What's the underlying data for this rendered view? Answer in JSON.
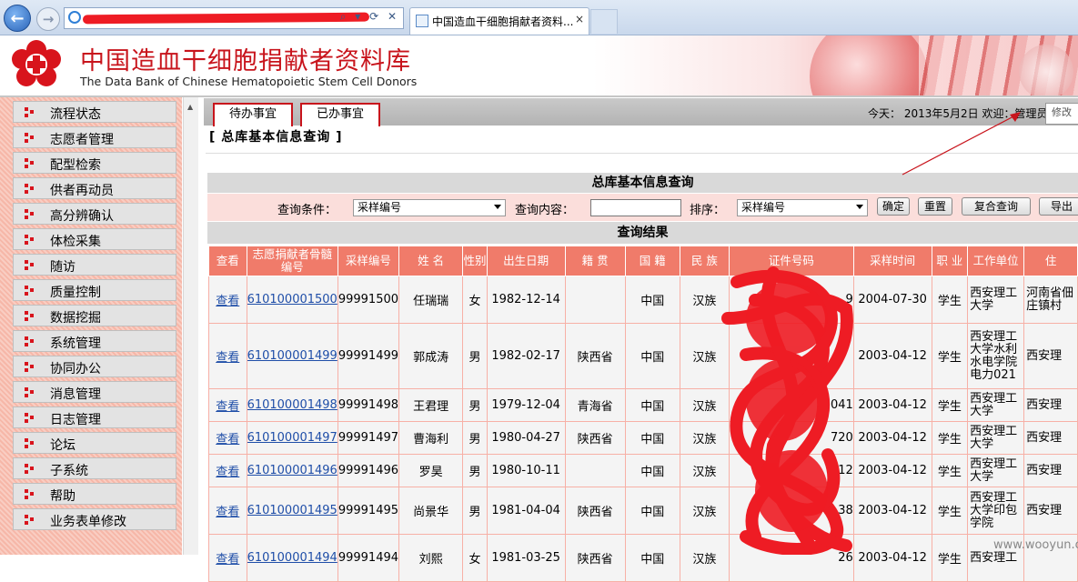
{
  "browser": {
    "tab_title": "中国造血干细胞捐献者资料...",
    "tab_close": "×",
    "address_tools": "⌕ ▾ ⟳ ✕"
  },
  "header": {
    "title_cn": "中国造血干细胞捐献者资料库",
    "title_en": "The Data Bank of Chinese Hematopoietic Stem Cell Donors"
  },
  "sidebar": {
    "items": [
      {
        "label": "流程状态"
      },
      {
        "label": "志愿者管理"
      },
      {
        "label": "配型检索"
      },
      {
        "label": "供者再动员"
      },
      {
        "label": "高分辨确认"
      },
      {
        "label": "体检采集"
      },
      {
        "label": "随访"
      },
      {
        "label": "质量控制"
      },
      {
        "label": "数据挖掘"
      },
      {
        "label": "系统管理"
      },
      {
        "label": "协同办公"
      },
      {
        "label": "消息管理"
      },
      {
        "label": "日志管理"
      },
      {
        "label": "论坛"
      },
      {
        "label": "子系统"
      },
      {
        "label": "帮助"
      },
      {
        "label": "业务表单修改"
      }
    ]
  },
  "main_tabs": {
    "pending": "待办事宜",
    "done": "已办事宜"
  },
  "status": {
    "date_text": "今天： 2013年5月2日 欢迎：管理员",
    "modify_label": "修改"
  },
  "page_title": "[ 总库基本信息查询 ]",
  "query": {
    "header": "总库基本信息查询",
    "condition_label": "查询条件：",
    "condition_value": "采样编号",
    "content_label": "查询内容：",
    "content_value": "",
    "sort_label": "排序：",
    "sort_value": "采样编号",
    "buttons": {
      "confirm": "确定",
      "reset": "重置",
      "compound": "复合查询",
      "export": "导出"
    }
  },
  "results": {
    "header": "查询结果",
    "columns": [
      "查看",
      "志愿捐献者骨髓编号",
      "采样编号",
      "姓 名",
      "性别",
      "出生日期",
      "籍 贯",
      "国 籍",
      "民 族",
      "证件号码",
      "采样时间",
      "职 业",
      "工作单位",
      "住"
    ],
    "rows": [
      {
        "view": "查看",
        "marrow_no": "610100001500",
        "sample_no": "99991500",
        "name": "任瑞瑞",
        "sex": "女",
        "birth": "1982-12-14",
        "native": "",
        "nation": "中国",
        "ethnic": "汉族",
        "id_tail": "9",
        "sample_time": "2004-07-30",
        "job": "学生",
        "unit": "西安理工大学",
        "addr": "河南省佃庄镇村"
      },
      {
        "view": "查看",
        "marrow_no": "610100001499",
        "sample_no": "99991499",
        "name": "郭成涛",
        "sex": "男",
        "birth": "1982-02-17",
        "native": "陕西省",
        "nation": "中国",
        "ethnic": "汉族",
        "id_tail": "",
        "sample_time": "2003-04-12",
        "job": "学生",
        "unit": "西安理工大学水利水电学院电力021",
        "addr": "西安理"
      },
      {
        "view": "查看",
        "marrow_no": "610100001498",
        "sample_no": "99991498",
        "name": "王君理",
        "sex": "男",
        "birth": "1979-12-04",
        "native": "青海省",
        "nation": "中国",
        "ethnic": "汉族",
        "id_tail": "041",
        "sample_time": "2003-04-12",
        "job": "学生",
        "unit": "西安理工大学",
        "addr": "西安理"
      },
      {
        "view": "查看",
        "marrow_no": "610100001497",
        "sample_no": "99991497",
        "name": "曹海利",
        "sex": "男",
        "birth": "1980-04-27",
        "native": "陕西省",
        "nation": "中国",
        "ethnic": "汉族",
        "id_tail": "720",
        "sample_time": "2003-04-12",
        "job": "学生",
        "unit": "西安理工大学",
        "addr": "西安理"
      },
      {
        "view": "查看",
        "marrow_no": "610100001496",
        "sample_no": "99991496",
        "name": "罗昊",
        "sex": "男",
        "birth": "1980-10-11",
        "native": "",
        "nation": "中国",
        "ethnic": "汉族",
        "id_tail": "12",
        "sample_time": "2003-04-12",
        "job": "学生",
        "unit": "西安理工大学",
        "addr": "西安理"
      },
      {
        "view": "查看",
        "marrow_no": "610100001495",
        "sample_no": "99991495",
        "name": "尚景华",
        "sex": "男",
        "birth": "1981-04-04",
        "native": "陕西省",
        "nation": "中国",
        "ethnic": "汉族",
        "id_tail": "38",
        "sample_time": "2003-04-12",
        "job": "学生",
        "unit": "西安理工大学印包学院",
        "addr": "西安理"
      },
      {
        "view": "查看",
        "marrow_no": "610100001494",
        "sample_no": "99991494",
        "name": "刘熙",
        "sex": "女",
        "birth": "1981-03-25",
        "native": "陕西省",
        "nation": "中国",
        "ethnic": "汉族",
        "id_tail": "26",
        "sample_time": "2003-04-12",
        "job": "学生",
        "unit": "西安理工",
        "addr": ""
      }
    ]
  },
  "watermark": "www.wooyun.org",
  "colors": {
    "brand_red": "#c8141c",
    "header_row": "#f07b6a",
    "query_bg": "#fbdedb"
  }
}
